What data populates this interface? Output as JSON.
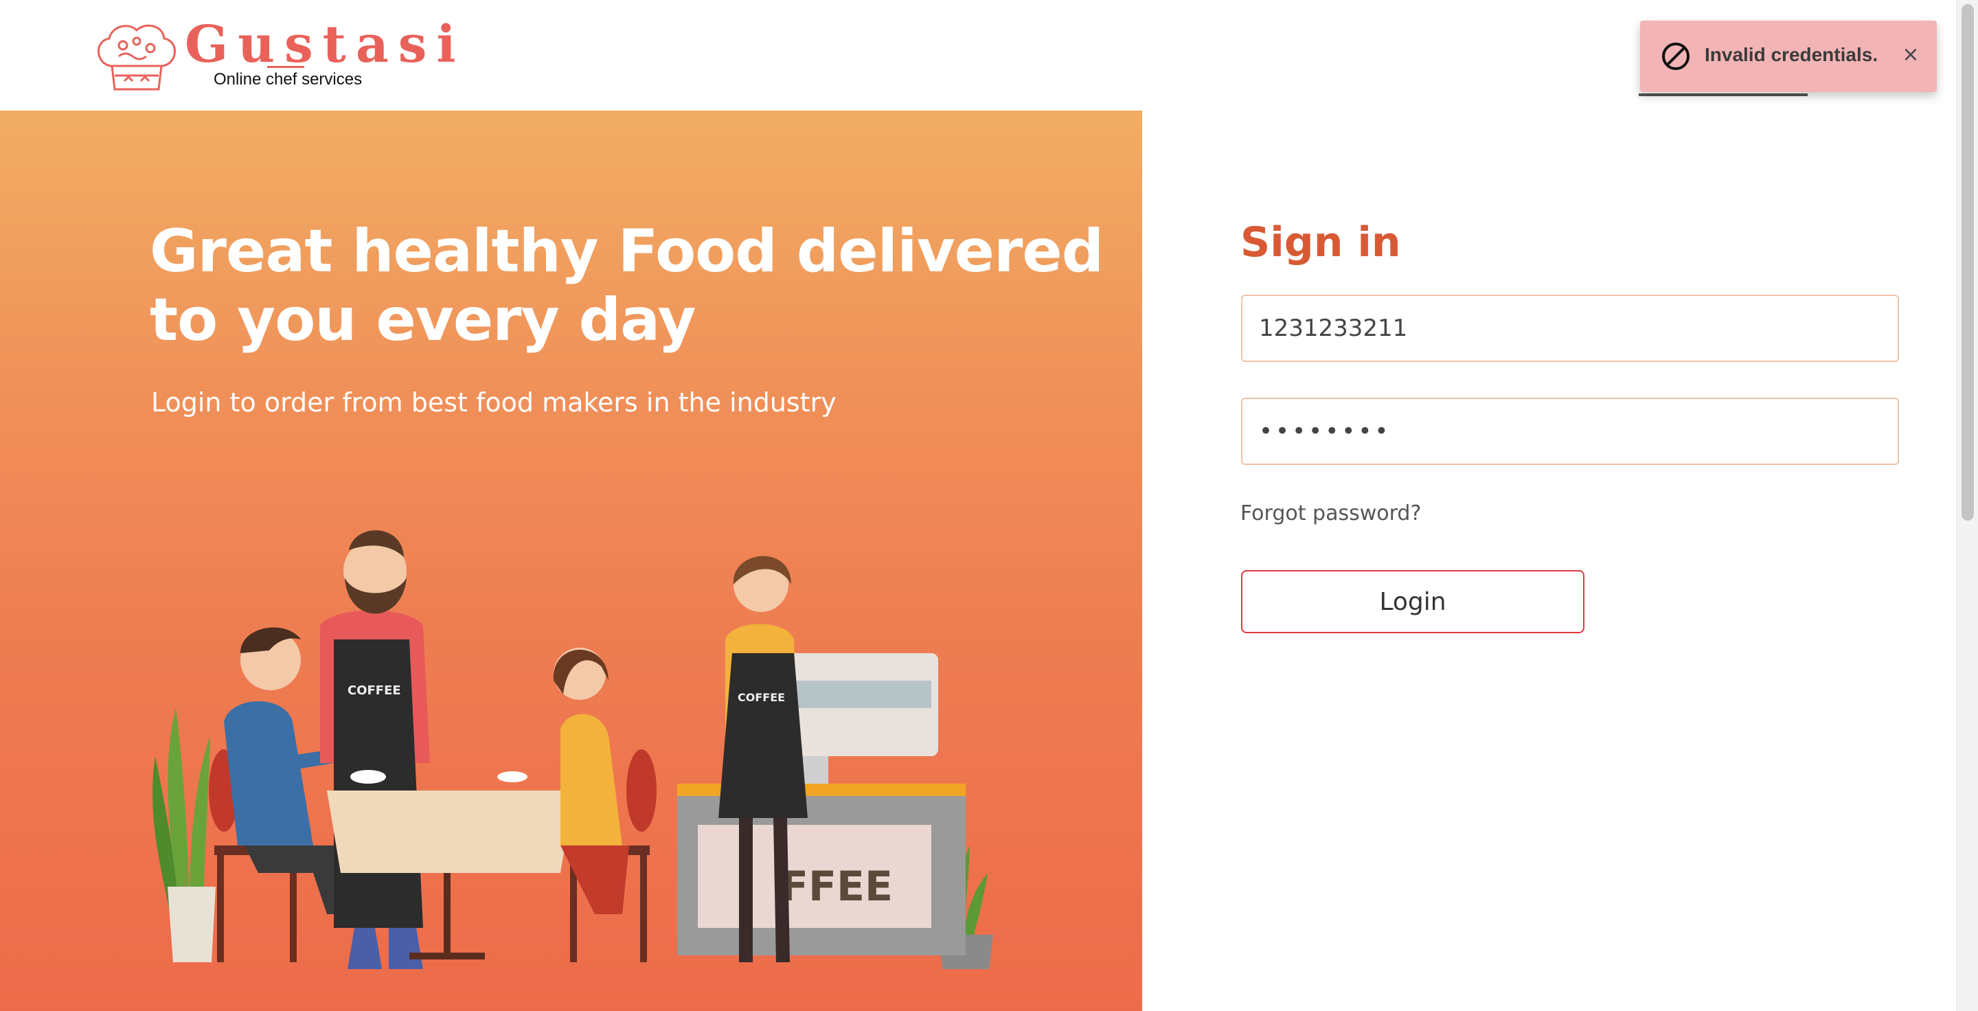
{
  "brand": {
    "name": "Gustasi",
    "tagline": "Online chef services",
    "accent": "#e8625a"
  },
  "toast": {
    "message": "Invalid credentials.",
    "icon": "prohibited-icon",
    "close_icon": "close-icon",
    "close_glyph": "×",
    "background": "#f3b4b5"
  },
  "hero": {
    "title": "Great healthy Food delivered to you every day",
    "subtitle": "Login to order from best food makers in the industry",
    "gradient_top": "#f1ad63",
    "gradient_bottom": "#ed6b4a",
    "illustration": {
      "mug_label": "COFFEE",
      "apron_label": "COFFEE",
      "counter_sign": "FFEE"
    }
  },
  "signin": {
    "title": "Sign in",
    "username_value": "1231233211",
    "password_value": "12345678",
    "forgot_label": "Forgot password?",
    "login_label": "Login",
    "title_color": "#d85a35",
    "button_border": "#e1383f"
  }
}
